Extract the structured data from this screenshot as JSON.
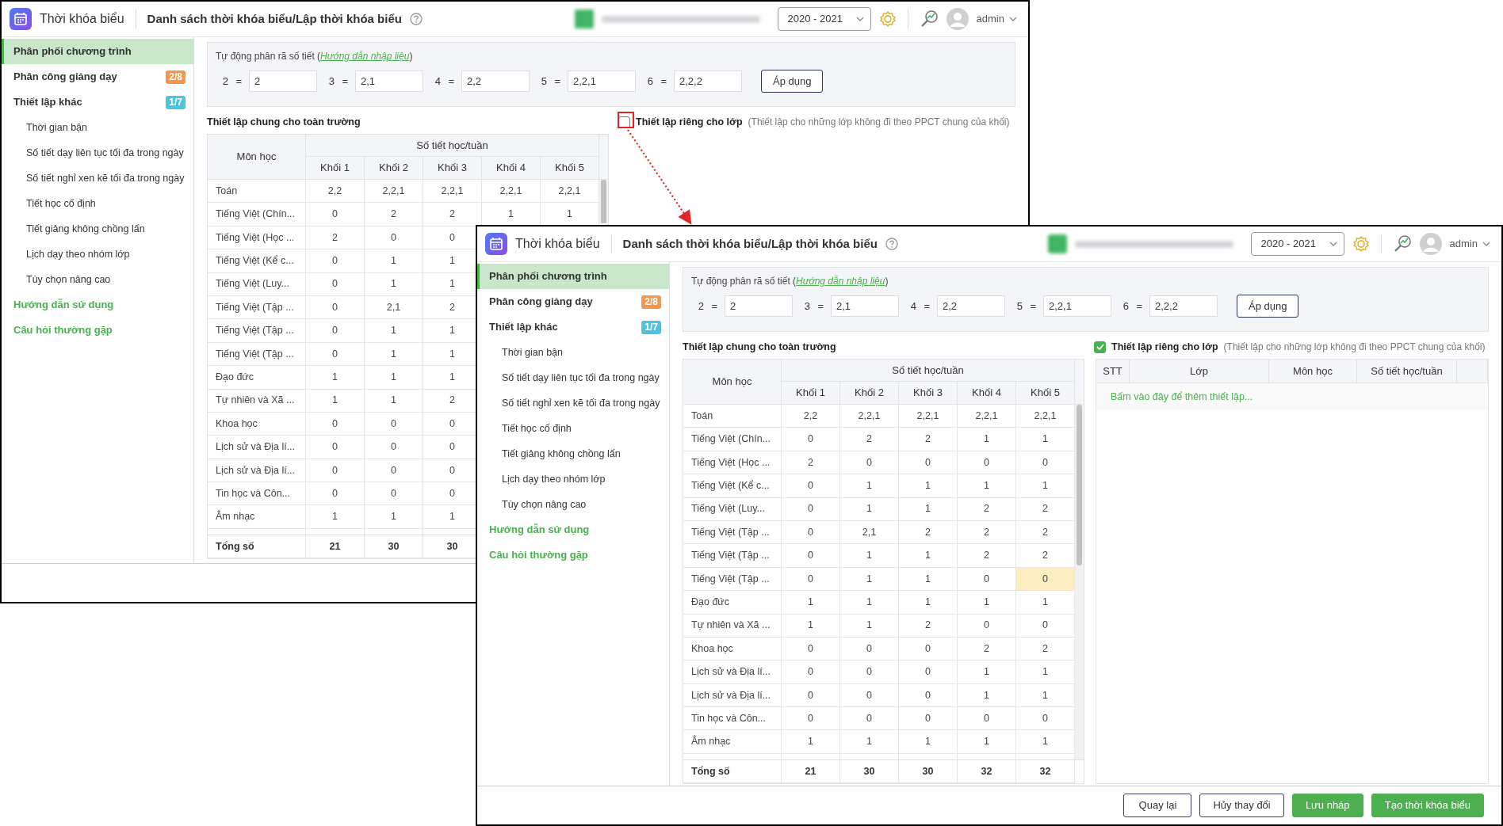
{
  "windows": [
    {
      "title": "Thời khóa biểu",
      "page_title": "Danh sách thời khóa biểu/Lập thời khóa biểu",
      "year": "2020 - 2021",
      "user": "admin",
      "sidebar": [
        {
          "label": "Phân phối chương trình",
          "kind": "section",
          "selected": true
        },
        {
          "label": "Phân công giảng dạy",
          "kind": "section",
          "selected": false,
          "badge": "2/8",
          "color": "#f7964b"
        },
        {
          "label": "Thiết lập khác",
          "kind": "section",
          "selected": false,
          "badge": "1/7",
          "color": "#4cc4e0"
        },
        {
          "label": "Thời gian bận",
          "kind": "sub",
          "selected": false
        },
        {
          "label": "Số tiết dạy liên tục tối đa trong ngày",
          "kind": "sub",
          "selected": false
        },
        {
          "label": "Số tiết nghỉ xen kẽ tối đa trong ngày",
          "kind": "sub",
          "selected": false
        },
        {
          "label": "Tiết học cố định",
          "kind": "sub",
          "selected": false
        },
        {
          "label": "Tiết giảng không chồng lấn",
          "kind": "sub",
          "selected": false
        },
        {
          "label": "Lịch dạy theo nhóm lớp",
          "kind": "sub",
          "selected": false
        },
        {
          "label": "Tùy chọn nâng cao",
          "kind": "sub",
          "selected": false
        },
        {
          "label": "Hướng dẫn sử dụng",
          "kind": "link",
          "selected": false
        },
        {
          "label": "Câu hỏi thường gặp",
          "kind": "link",
          "selected": false
        }
      ],
      "auto_split": {
        "label": "Tự động phân rã số tiết (",
        "link": "Hướng dẫn nhập liệu",
        "label_end": ")",
        "apply_button": "Áp dụng",
        "fields": [
          {
            "label": "2 =",
            "value": "2"
          },
          {
            "label": "3 =",
            "value": "2,1"
          },
          {
            "label": "4 =",
            "value": "2,2"
          },
          {
            "label": "5 =",
            "value": "2,2,1"
          },
          {
            "label": "6 =",
            "value": "2,2,2"
          }
        ]
      },
      "general_title": "Thiết lập chung cho toàn trường",
      "class_setting": {
        "checked": false,
        "title": "Thiết lập riêng cho lớp",
        "note": "(Thiết lập cho những lớp không đi theo PPCT chung của khối)"
      },
      "table": {
        "subject_header": "Môn học",
        "group_header": "Số tiết học/tuần",
        "columns": [
          "Khối 1",
          "Khối 2",
          "Khối 3",
          "Khối 4",
          "Khối 5"
        ],
        "rows": [
          {
            "subject": "Toán",
            "values": [
              "2,2",
              "2,2,1",
              "2,2,1",
              "2,2,1",
              "2,2,1"
            ]
          },
          {
            "subject": "Tiếng Việt (Chín...",
            "values": [
              "0",
              "2",
              "2",
              "1",
              "1"
            ]
          },
          {
            "subject": "Tiếng Việt (Học ...",
            "values": [
              "2",
              "0",
              "0"
            ]
          },
          {
            "subject": "Tiếng Việt (Kể c...",
            "values": [
              "0",
              "1",
              "1"
            ]
          },
          {
            "subject": "Tiếng Việt (Luy...",
            "values": [
              "0",
              "1",
              "1"
            ]
          },
          {
            "subject": "Tiếng Việt (Tập ...",
            "values": [
              "0",
              "2,1",
              "2"
            ]
          },
          {
            "subject": "Tiếng Việt (Tập ...",
            "values": [
              "0",
              "1",
              "1"
            ]
          },
          {
            "subject": "Tiếng Việt (Tập ...",
            "values": [
              "0",
              "1",
              "1"
            ]
          },
          {
            "subject": "Đạo đức",
            "values": [
              "1",
              "1",
              "1"
            ]
          },
          {
            "subject": "Tự nhiên và Xã ...",
            "values": [
              "1",
              "1",
              "2"
            ]
          },
          {
            "subject": "Khoa học",
            "values": [
              "0",
              "0",
              "0"
            ]
          },
          {
            "subject": "Lịch sử và Địa lí...",
            "values": [
              "0",
              "0",
              "0"
            ]
          },
          {
            "subject": "Lịch sử và Địa lí...",
            "values": [
              "0",
              "0",
              "0"
            ]
          },
          {
            "subject": "Tin học và Côn...",
            "values": [
              "0",
              "0",
              "0"
            ]
          },
          {
            "subject": "Âm nhạc",
            "values": [
              "1",
              "1",
              "1"
            ]
          }
        ],
        "total": {
          "label": "Tổng số",
          "values": [
            "21",
            "30",
            "30"
          ]
        }
      }
    },
    {
      "title": "Thời khóa biểu",
      "page_title": "Danh sách thời khóa biểu/Lập thời khóa biểu",
      "year": "2020 - 2021",
      "user": "admin",
      "sidebar": [
        {
          "label": "Phân phối chương trình",
          "kind": "section",
          "selected": true
        },
        {
          "label": "Phân công giảng dạy",
          "kind": "section",
          "selected": false,
          "badge": "2/8",
          "color": "#f7964b"
        },
        {
          "label": "Thiết lập khác",
          "kind": "section",
          "selected": false,
          "badge": "1/7",
          "color": "#4cc4e0"
        },
        {
          "label": "Thời gian bận",
          "kind": "sub",
          "selected": false
        },
        {
          "label": "Số tiết dạy liên tục tối đa trong ngày",
          "kind": "sub",
          "selected": false
        },
        {
          "label": "Số tiết nghỉ xen kẽ tối đa trong ngày",
          "kind": "sub",
          "selected": false
        },
        {
          "label": "Tiết học cố định",
          "kind": "sub",
          "selected": false
        },
        {
          "label": "Tiết giảng không chồng lấn",
          "kind": "sub",
          "selected": false
        },
        {
          "label": "Lịch dạy theo nhóm lớp",
          "kind": "sub",
          "selected": false
        },
        {
          "label": "Tùy chọn nâng cao",
          "kind": "sub",
          "selected": false
        },
        {
          "label": "Hướng dẫn sử dụng",
          "kind": "link",
          "selected": false
        },
        {
          "label": "Câu hỏi thường gặp",
          "kind": "link",
          "selected": false
        }
      ],
      "auto_split": {
        "label": "Tự động phân rã số tiết (",
        "link": "Hướng dẫn nhập liệu",
        "label_end": ")",
        "apply_button": "Áp dụng",
        "fields": [
          {
            "label": "2 =",
            "value": "2"
          },
          {
            "label": "3 =",
            "value": "2,1"
          },
          {
            "label": "4 =",
            "value": "2,2"
          },
          {
            "label": "5 =",
            "value": "2,2,1"
          },
          {
            "label": "6 =",
            "value": "2,2,2"
          }
        ]
      },
      "general_title": "Thiết lập chung cho toàn trường",
      "class_setting": {
        "checked": true,
        "title": "Thiết lập riêng cho lớp",
        "note": "(Thiết lập cho những lớp không đi theo PPCT chung của khối)"
      },
      "table": {
        "subject_header": "Môn học",
        "group_header": "Số tiết học/tuần",
        "columns": [
          "Khối 1",
          "Khối 2",
          "Khối 3",
          "Khối 4",
          "Khối 5"
        ],
        "rows": [
          {
            "subject": "Toán",
            "values": [
              "2,2",
              "2,2,1",
              "2,2,1",
              "2,2,1",
              "2,2,1"
            ],
            "highlighted": [
              false,
              false,
              false,
              false,
              false
            ]
          },
          {
            "subject": "Tiếng Việt (Chín...",
            "values": [
              "0",
              "2",
              "2",
              "1",
              "1"
            ],
            "highlighted": [
              false,
              false,
              false,
              false,
              false
            ]
          },
          {
            "subject": "Tiếng Việt (Học ...",
            "values": [
              "2",
              "0",
              "0",
              "0",
              "0"
            ],
            "highlighted": [
              false,
              false,
              false,
              false,
              false
            ]
          },
          {
            "subject": "Tiếng Việt (Kể c...",
            "values": [
              "0",
              "1",
              "1",
              "1",
              "1"
            ],
            "highlighted": [
              false,
              false,
              false,
              false,
              false
            ]
          },
          {
            "subject": "Tiếng Việt (Luy...",
            "values": [
              "0",
              "1",
              "1",
              "2",
              "2"
            ],
            "highlighted": [
              false,
              false,
              false,
              false,
              false
            ]
          },
          {
            "subject": "Tiếng Việt (Tập ...",
            "values": [
              "0",
              "2,1",
              "2",
              "2",
              "2"
            ],
            "highlighted": [
              false,
              false,
              false,
              false,
              false
            ]
          },
          {
            "subject": "Tiếng Việt (Tập ...",
            "values": [
              "0",
              "1",
              "1",
              "2",
              "2"
            ],
            "highlighted": [
              false,
              false,
              false,
              false,
              false
            ]
          },
          {
            "subject": "Tiếng Việt (Tập ...",
            "values": [
              "0",
              "1",
              "1",
              "0",
              "0"
            ],
            "highlighted": [
              false,
              false,
              false,
              false,
              true
            ]
          },
          {
            "subject": "Đạo đức",
            "values": [
              "1",
              "1",
              "1",
              "1",
              "1"
            ],
            "highlighted": [
              false,
              false,
              false,
              false,
              false
            ]
          },
          {
            "subject": "Tự nhiên và Xã ...",
            "values": [
              "1",
              "1",
              "2",
              "0",
              "0"
            ],
            "highlighted": [
              false,
              false,
              false,
              false,
              false
            ]
          },
          {
            "subject": "Khoa học",
            "values": [
              "0",
              "0",
              "0",
              "2",
              "2"
            ],
            "highlighted": [
              false,
              false,
              false,
              false,
              false
            ]
          },
          {
            "subject": "Lịch sử và Địa lí...",
            "values": [
              "0",
              "0",
              "0",
              "1",
              "1"
            ],
            "highlighted": [
              false,
              false,
              false,
              false,
              false
            ]
          },
          {
            "subject": "Lịch sử và Địa lí...",
            "values": [
              "0",
              "0",
              "0",
              "1",
              "1"
            ],
            "highlighted": [
              false,
              false,
              false,
              false,
              false
            ]
          },
          {
            "subject": "Tin học và Côn...",
            "values": [
              "0",
              "0",
              "0",
              "0",
              "0"
            ],
            "highlighted": [
              false,
              false,
              false,
              false,
              false
            ]
          },
          {
            "subject": "Âm nhạc",
            "values": [
              "1",
              "1",
              "1",
              "1",
              "1"
            ],
            "highlighted": [
              false,
              false,
              false,
              false,
              false
            ]
          }
        ],
        "total": {
          "label": "Tổng số",
          "values": [
            "21",
            "30",
            "30",
            "32",
            "32"
          ]
        }
      },
      "class_table": {
        "columns": [
          "STT",
          "Lớp",
          "Môn học",
          "Số tiết học/tuần"
        ],
        "add_row": "Bấm vào đây để thêm thiết lập..."
      },
      "buttons": [
        {
          "label": "Quay lại",
          "kind": "outline"
        },
        {
          "label": "Hủy thay đổi",
          "kind": "outline"
        },
        {
          "label": "Lưu nháp",
          "kind": "primary"
        },
        {
          "label": "Tạo thời khóa biểu",
          "kind": "primary"
        }
      ]
    }
  ]
}
